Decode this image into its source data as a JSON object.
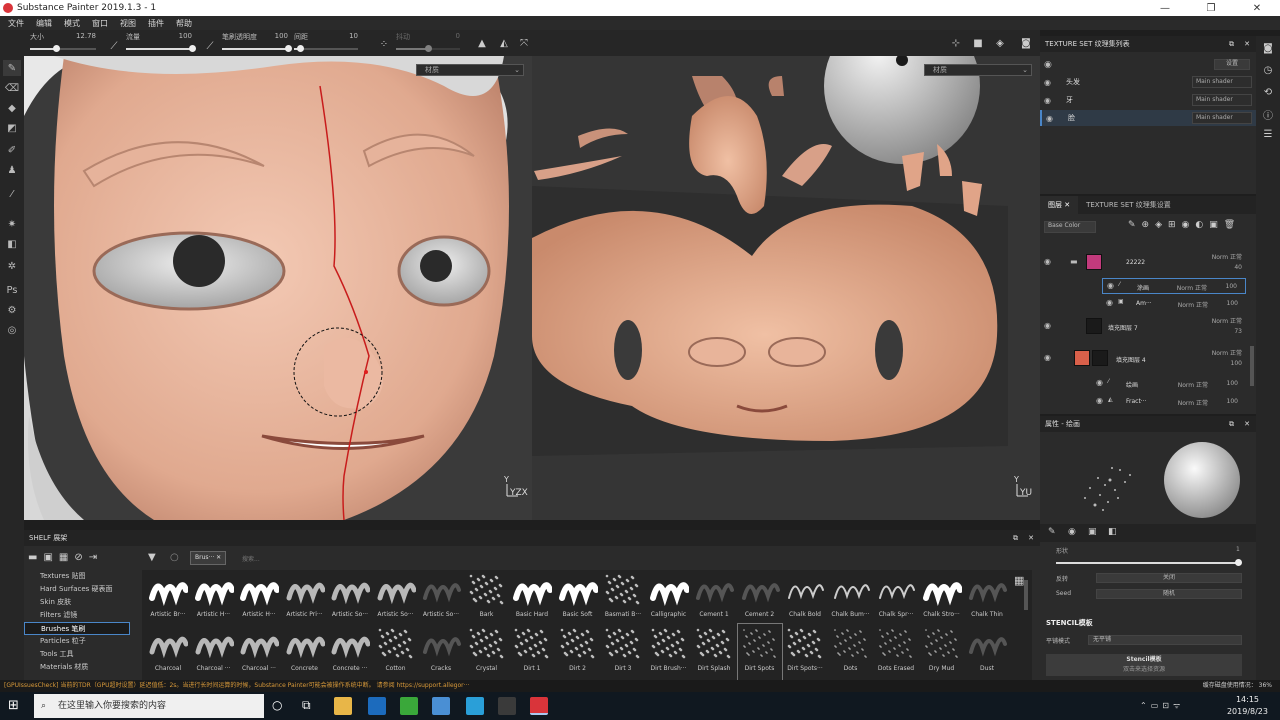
{
  "window": {
    "title": "Substance Painter 2019.1.3 - 1",
    "min": "—",
    "max": "❐",
    "close": "✕"
  },
  "menu": [
    "文件",
    "编辑",
    "模式",
    "窗口",
    "视图",
    "插件",
    "帮助"
  ],
  "toolbar": {
    "size": {
      "label": "大小",
      "value": "12.78",
      "fraction": 0.4
    },
    "flow": {
      "label": "流量",
      "value": "100",
      "fraction": 1.0
    },
    "stroke_opacity": {
      "label": "笔刷透明度",
      "value": "100",
      "fraction": 1.0
    },
    "spacing": {
      "label": "间距",
      "value": "10",
      "fraction": 0.1
    },
    "jitter": {
      "label": "抖动",
      "value": "0",
      "fraction": 0.5
    }
  },
  "viewport3d": {
    "material_dropdown": "材质",
    "axes": "YZX"
  },
  "viewport2d": {
    "material_dropdown": "材质",
    "axes": "YU"
  },
  "texture_set_list": {
    "title": "TEXTURE SET 纹理集列表",
    "settings_button": "设置",
    "rows": [
      {
        "name": "头发",
        "shader": "Main shader"
      },
      {
        "name": "牙",
        "shader": "Main shader"
      },
      {
        "name": "脸",
        "shader": "Main shader"
      }
    ]
  },
  "layers_panel": {
    "tabs": [
      "图层",
      "TEXTURE SET 纹理集设置"
    ],
    "channel_dropdown": "Base Color",
    "layers": [
      {
        "name": "22222",
        "blend": "Norm 正常",
        "opacity": "40",
        "thumb_color": "#c23a7c",
        "folder": true
      },
      {
        "name": "涂画",
        "blend": "Norm 正常",
        "opacity": "100",
        "sub": true
      },
      {
        "name": "Am···",
        "blend": "Norm 正常",
        "opacity": "100",
        "sub": true
      },
      {
        "name": "填充图层 7",
        "blend": "Norm 正常",
        "opacity": "73",
        "thumb_color": "#1a1a1a"
      },
      {
        "name": "填充图层 4",
        "blend": "Norm 正常",
        "opacity": "100",
        "thumb_color": "#d9604a"
      },
      {
        "name": "绘画",
        "blend": "Norm 正常",
        "opacity": "100",
        "sub": true
      },
      {
        "name": "Fract···",
        "blend": "Norm 正常",
        "opacity": "100",
        "sub": true
      }
    ]
  },
  "properties": {
    "title": "属性 - 绘画",
    "shape_label": "形状",
    "shape_value": "1",
    "flip_label": "反转",
    "flip_value": "关闭",
    "seed_label": "Seed",
    "seed_value": "随机",
    "stencil_title": "STENCIL模板",
    "tile_label": "平铺模式",
    "tile_value": "无平铺",
    "stencil_button": "Stencil模板",
    "stencil_hint": "双击来选择资源"
  },
  "shelf": {
    "title": "SHELF 展架",
    "filter_tag": "Brus···",
    "search_placeholder": "搜索...",
    "categories": [
      "Textures 贴图",
      "Hard Surfaces 硬表面",
      "Skin 皮肤",
      "Filters 滤镜",
      "Brushes 笔刷",
      "Particles 粒子",
      "Tools 工具",
      "Materials 材质"
    ],
    "selected_category": "Brushes 笔刷",
    "brushes_row1": [
      "Artistic Br···",
      "Artistic H···",
      "Artistic H···",
      "Artistic Pri···",
      "Artistic So···",
      "Artistic So···",
      "Artistic So···",
      "Bark",
      "Basic Hard",
      "Basic Soft",
      "Basmati B···",
      "Calligraphic",
      "Cement 1",
      "Cement 2",
      "Chalk Bold",
      "Chalk Bum···",
      "Chalk Spr···",
      "Chalk Stro···",
      "Chalk Thin"
    ],
    "brushes_row2": [
      "Charcoal",
      "Charcoal ···",
      "Charcoal ···",
      "Concrete",
      "Concrete ···",
      "Cotton",
      "Cracks",
      "Crystal",
      "Dirt 1",
      "Dirt 2",
      "Dirt 3",
      "Dirt Brush···",
      "Dirt Splash",
      "Dirt Spots",
      "Dirt Spots···",
      "Dots",
      "Dots Erased",
      "Dry Mud",
      "Dust"
    ],
    "selected_brush": "Dirt Spots"
  },
  "status": {
    "message": "[GPUIssuesCheck] 当前的TDR（GPU超时设置）延迟值低：2s。当进行长时间运算的时候，Substance Painter可能会被操作系统中断。 请参阅 https://support.allegor···",
    "right": "缓存磁盘使用情况：",
    "percent": "36%"
  },
  "taskbar": {
    "search_placeholder": "在这里输入你要搜索的内容",
    "time": "14:15",
    "date": "2019/8/23"
  }
}
